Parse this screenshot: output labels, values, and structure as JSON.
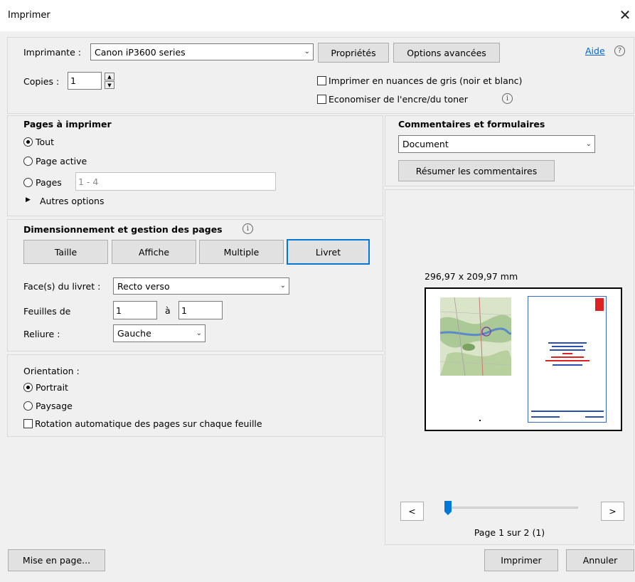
{
  "window": {
    "title": "Imprimer",
    "close_glyph": "✕"
  },
  "printer": {
    "label": "Imprimante :",
    "selected": "Canon iP3600 series",
    "properties_button": "Propriétés",
    "advanced_button": "Options avancées",
    "help_link": "Aide",
    "copies_label": "Copies :",
    "copies_value": "1",
    "grayscale_label": "Imprimer en nuances de gris (noir et blanc)",
    "save_ink_label": "Economiser de l'encre/du toner",
    "info_glyph": "i"
  },
  "pages": {
    "heading": "Pages à imprimer",
    "all_label": "Tout",
    "current_label": "Page active",
    "range_label": "Pages",
    "range_value": "1 - 4",
    "more_options": "Autres options"
  },
  "sizing": {
    "heading": "Dimensionnement et gestion des pages",
    "tabs": [
      "Taille",
      "Affiche",
      "Multiple",
      "Livret"
    ],
    "active_tab": "Livret",
    "sides_label": "Face(s) du livret :",
    "sides_value": "Recto verso",
    "sheets_label": "Feuilles de",
    "sheets_from": "1",
    "sheets_to_label": "à",
    "sheets_to": "1",
    "binding_label": "Reliure :",
    "binding_value": "Gauche"
  },
  "orientation": {
    "heading": "Orientation :",
    "portrait_label": "Portrait",
    "landscape_label": "Paysage",
    "auto_rotate_label": "Rotation automatique des pages sur chaque feuille"
  },
  "comments": {
    "heading": "Commentaires et formulaires",
    "selected": "Document",
    "summarize_button": "Résumer les commentaires"
  },
  "preview": {
    "dimensions": "296,97 x 209,97 mm",
    "page_indicator": "Page 1 sur 2 (1)",
    "prev_glyph": "<",
    "next_glyph": ">",
    "page_fraction": 0.5
  },
  "footer": {
    "page_setup_button": "Mise en page...",
    "print_button": "Imprimer",
    "cancel_button": "Annuler"
  },
  "colors": {
    "accent": "#0078d7",
    "link": "#0066cc"
  }
}
